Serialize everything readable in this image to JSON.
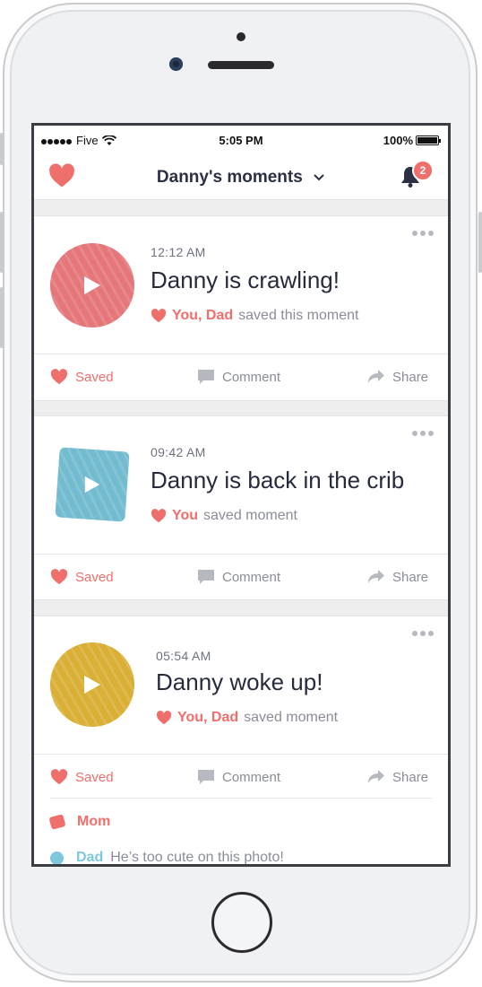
{
  "status_bar": {
    "carrier": "Five",
    "time": "5:05 PM",
    "battery": "100%"
  },
  "header": {
    "title": "Danny's moments",
    "notification_count": "2"
  },
  "colors": {
    "accent": "#ef6f6c",
    "title_text": "#2b3044",
    "muted": "#8a8d98"
  },
  "moments": [
    {
      "time": "12:12 AM",
      "title": "Danny is crawling!",
      "saved_by": "You, Dad",
      "saved_text": "saved this moment",
      "thumb_color": "#e5777a",
      "thumb_shape": "circle"
    },
    {
      "time": "09:42 AM",
      "title": "Danny is back in the crib",
      "saved_by": "You",
      "saved_text": "saved moment",
      "thumb_color": "#73bcd0",
      "thumb_shape": "square"
    },
    {
      "time": "05:54 AM",
      "title": "Danny woke up!",
      "saved_by": "You, Dad",
      "saved_text": "saved moment",
      "thumb_color": "#d9b035",
      "thumb_shape": "circle"
    }
  ],
  "actions": {
    "saved": "Saved",
    "comment": "Comment",
    "share": "Share"
  },
  "comments": [
    {
      "author": "Mom",
      "text": ""
    },
    {
      "author": "Dad",
      "text": "He’s too cute on this photo!"
    }
  ]
}
